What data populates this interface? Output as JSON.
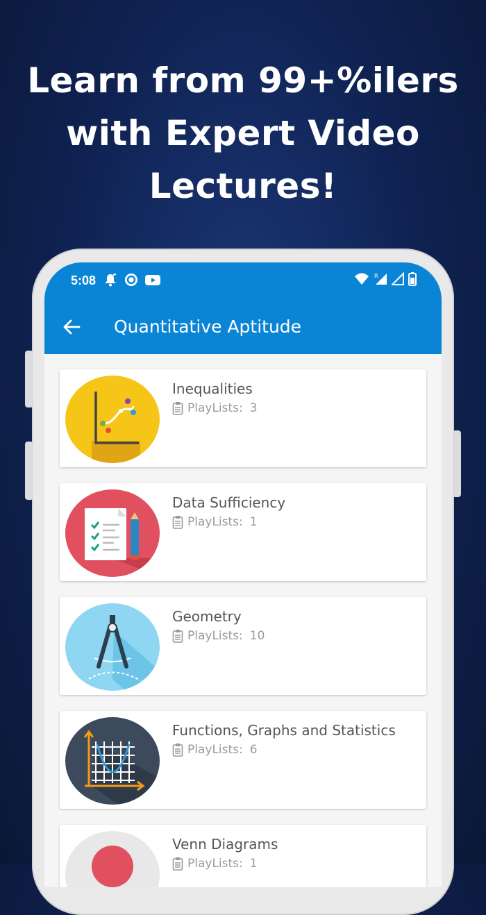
{
  "headline": {
    "line1": "Learn from 99+%ilers",
    "line2": "with Expert Video",
    "line3": "Lectures!"
  },
  "status_bar": {
    "time": "5:08",
    "left_icons": [
      "notification-bell-icon",
      "sync-circle-icon",
      "youtube-icon"
    ],
    "right_icons": [
      "wifi-icon",
      "roaming-signal-icon",
      "signal-icon",
      "battery-icon"
    ]
  },
  "toolbar": {
    "title": "Quantitative Aptitude",
    "back_icon": "arrow-back-icon"
  },
  "playlist_label": "PlayLists:",
  "topics": [
    {
      "title": "Inequalities",
      "count": "3",
      "icon": "graph-icon",
      "color": "#f5c518"
    },
    {
      "title": "Data Sufficiency",
      "count": "1",
      "icon": "checklist-icon",
      "color": "#e0505e"
    },
    {
      "title": "Geometry",
      "count": "10",
      "icon": "compass-icon",
      "color": "#8ed6f2"
    },
    {
      "title": "Functions, Graphs and Statistics",
      "count": "6",
      "icon": "grid-graph-icon",
      "color": "#3d4a5c"
    },
    {
      "title": "Venn Diagrams",
      "count": "1",
      "icon": "venn-icon",
      "color": "#e8e8e8"
    }
  ]
}
